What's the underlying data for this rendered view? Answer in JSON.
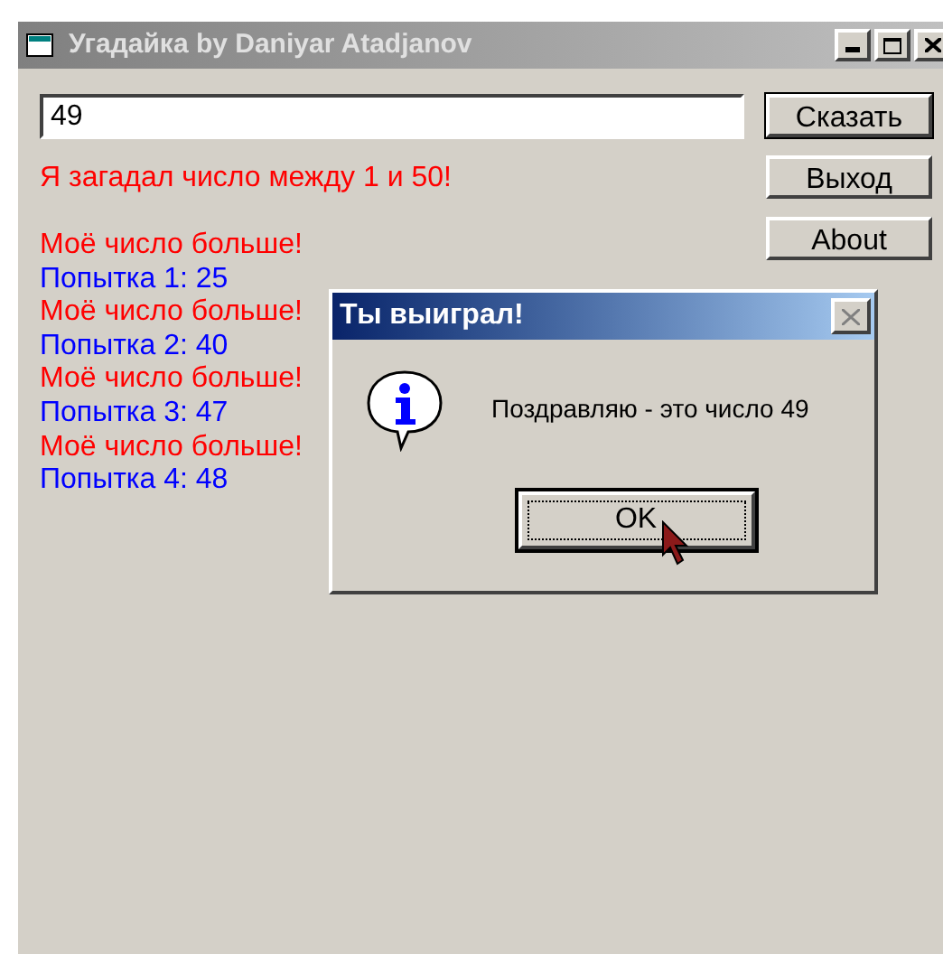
{
  "window": {
    "title": "Угадайка by Daniyar Atadjanov",
    "active": false
  },
  "input": {
    "value": "49"
  },
  "buttons": [
    {
      "label": "Сказать",
      "default": true
    },
    {
      "label": "Выход",
      "default": false
    },
    {
      "label": "About",
      "default": false
    }
  ],
  "prompt": "Я загадал число между 1 и 50!",
  "log": [
    {
      "kind": "hint",
      "text": "Моё число больше!"
    },
    {
      "kind": "guess",
      "text": "Попытка 1: 25"
    },
    {
      "kind": "hint",
      "text": "Моё число больше!"
    },
    {
      "kind": "guess",
      "text": "Попытка 2: 40"
    },
    {
      "kind": "hint",
      "text": "Моё число больше!"
    },
    {
      "kind": "guess",
      "text": "Попытка 3: 47"
    },
    {
      "kind": "hint",
      "text": "Моё число больше!"
    },
    {
      "kind": "guess",
      "text": "Попытка 4: 48"
    }
  ],
  "dialog": {
    "title": "Ты выиграл!",
    "message": "Поздравляю - это число 49",
    "button": "OK"
  }
}
